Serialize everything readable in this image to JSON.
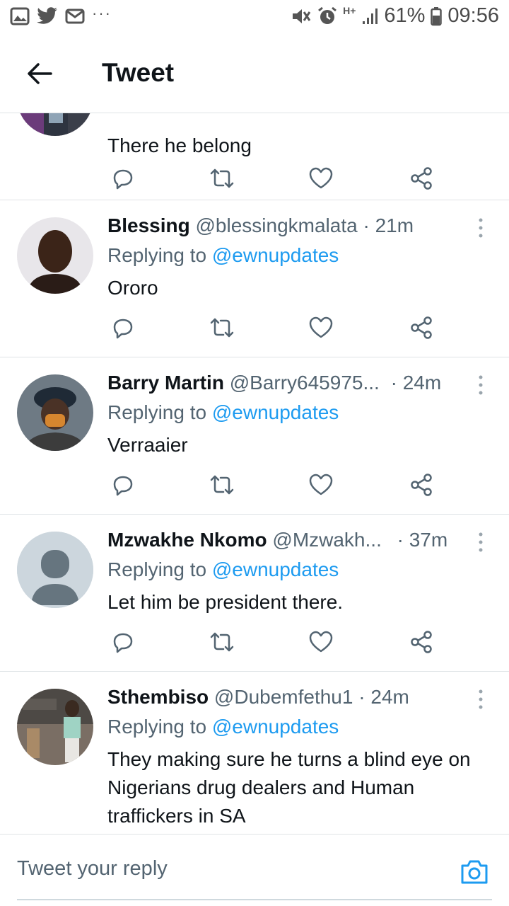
{
  "status_bar": {
    "left_icons": [
      "gallery-icon",
      "twitter-icon",
      "mail-icon",
      "more-dots-icon"
    ],
    "dots": "···",
    "right_icons": [
      "mute-icon",
      "alarm-icon",
      "hplus-icon",
      "signal-icon",
      "battery-icon"
    ],
    "network": "H+",
    "battery": "61%",
    "time": "09:56"
  },
  "header": {
    "title": "Tweet",
    "back_icon": "arrow-left-icon"
  },
  "tweets": [
    {
      "name": "",
      "handle": "",
      "time": "",
      "replying_prefix": "",
      "replying_to": "",
      "text": "There he belong"
    },
    {
      "name": "Blessing",
      "handle": "@blessingkmalata",
      "time": "· 21m",
      "replying_prefix": "Replying to",
      "replying_to": "@ewnupdates",
      "text": "Ororo"
    },
    {
      "name": "Barry Martin",
      "handle": "@Barry645975...",
      "time": "· 24m",
      "replying_prefix": "Replying to",
      "replying_to": "@ewnupdates",
      "text": "Verraaier"
    },
    {
      "name": "Mzwakhe Nkomo",
      "handle": "@Mzwakh...",
      "time": "· 37m",
      "replying_prefix": "Replying to",
      "replying_to": "@ewnupdates",
      "text": "Let him be president there."
    },
    {
      "name": "Sthembiso",
      "handle": "@Dubemfethu1",
      "time": "· 24m",
      "replying_prefix": "Replying to",
      "replying_to": "@ewnupdates",
      "text": "They making  sure he turns a blind eye on Nigerians drug dealers and Human traffickers in SA"
    }
  ],
  "action_icons": [
    "reply-icon",
    "retweet-icon",
    "like-icon",
    "share-icon"
  ],
  "reply_bar": {
    "placeholder": "Tweet your reply",
    "camera_icon": "camera-icon"
  },
  "colors": {
    "accent": "#1d9bf0",
    "text_primary": "#0f1419",
    "text_secondary": "#536471",
    "divider": "#dfe3e6"
  }
}
